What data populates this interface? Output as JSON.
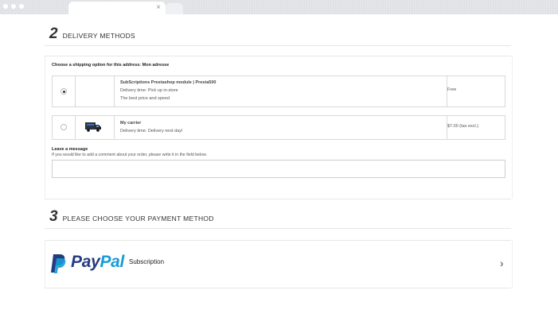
{
  "browser": {
    "tab_close": "×"
  },
  "delivery": {
    "step": "2",
    "title": "DELIVERY METHODS",
    "address_label": "Choose a shipping option for this address: Mon adresse",
    "options": [
      {
        "selected": true,
        "name": "SubScriptions Prestashop module | Presta500",
        "line1": "Delivery time: Pick up in-store",
        "line2": "The best price and speed",
        "price": "Free"
      },
      {
        "selected": false,
        "icon": "truck-icon",
        "name": "My carrier",
        "line1": "Delivery time: Delivery next day!",
        "price": "$7.00 (tax excl.)"
      }
    ],
    "message_title": "Leave a message",
    "message_help": "If you would like to add a comment about your order, please write it in the field below.",
    "message_value": ""
  },
  "payment": {
    "step": "3",
    "title": "PLEASE CHOOSE YOUR PAYMENT METHOD",
    "method_logo_part1": "Pay",
    "method_logo_part2": "Pal",
    "method_label": "Subscription",
    "chevron": "›",
    "brand_colors": {
      "dark": "#253b80",
      "light": "#179bd7"
    }
  }
}
